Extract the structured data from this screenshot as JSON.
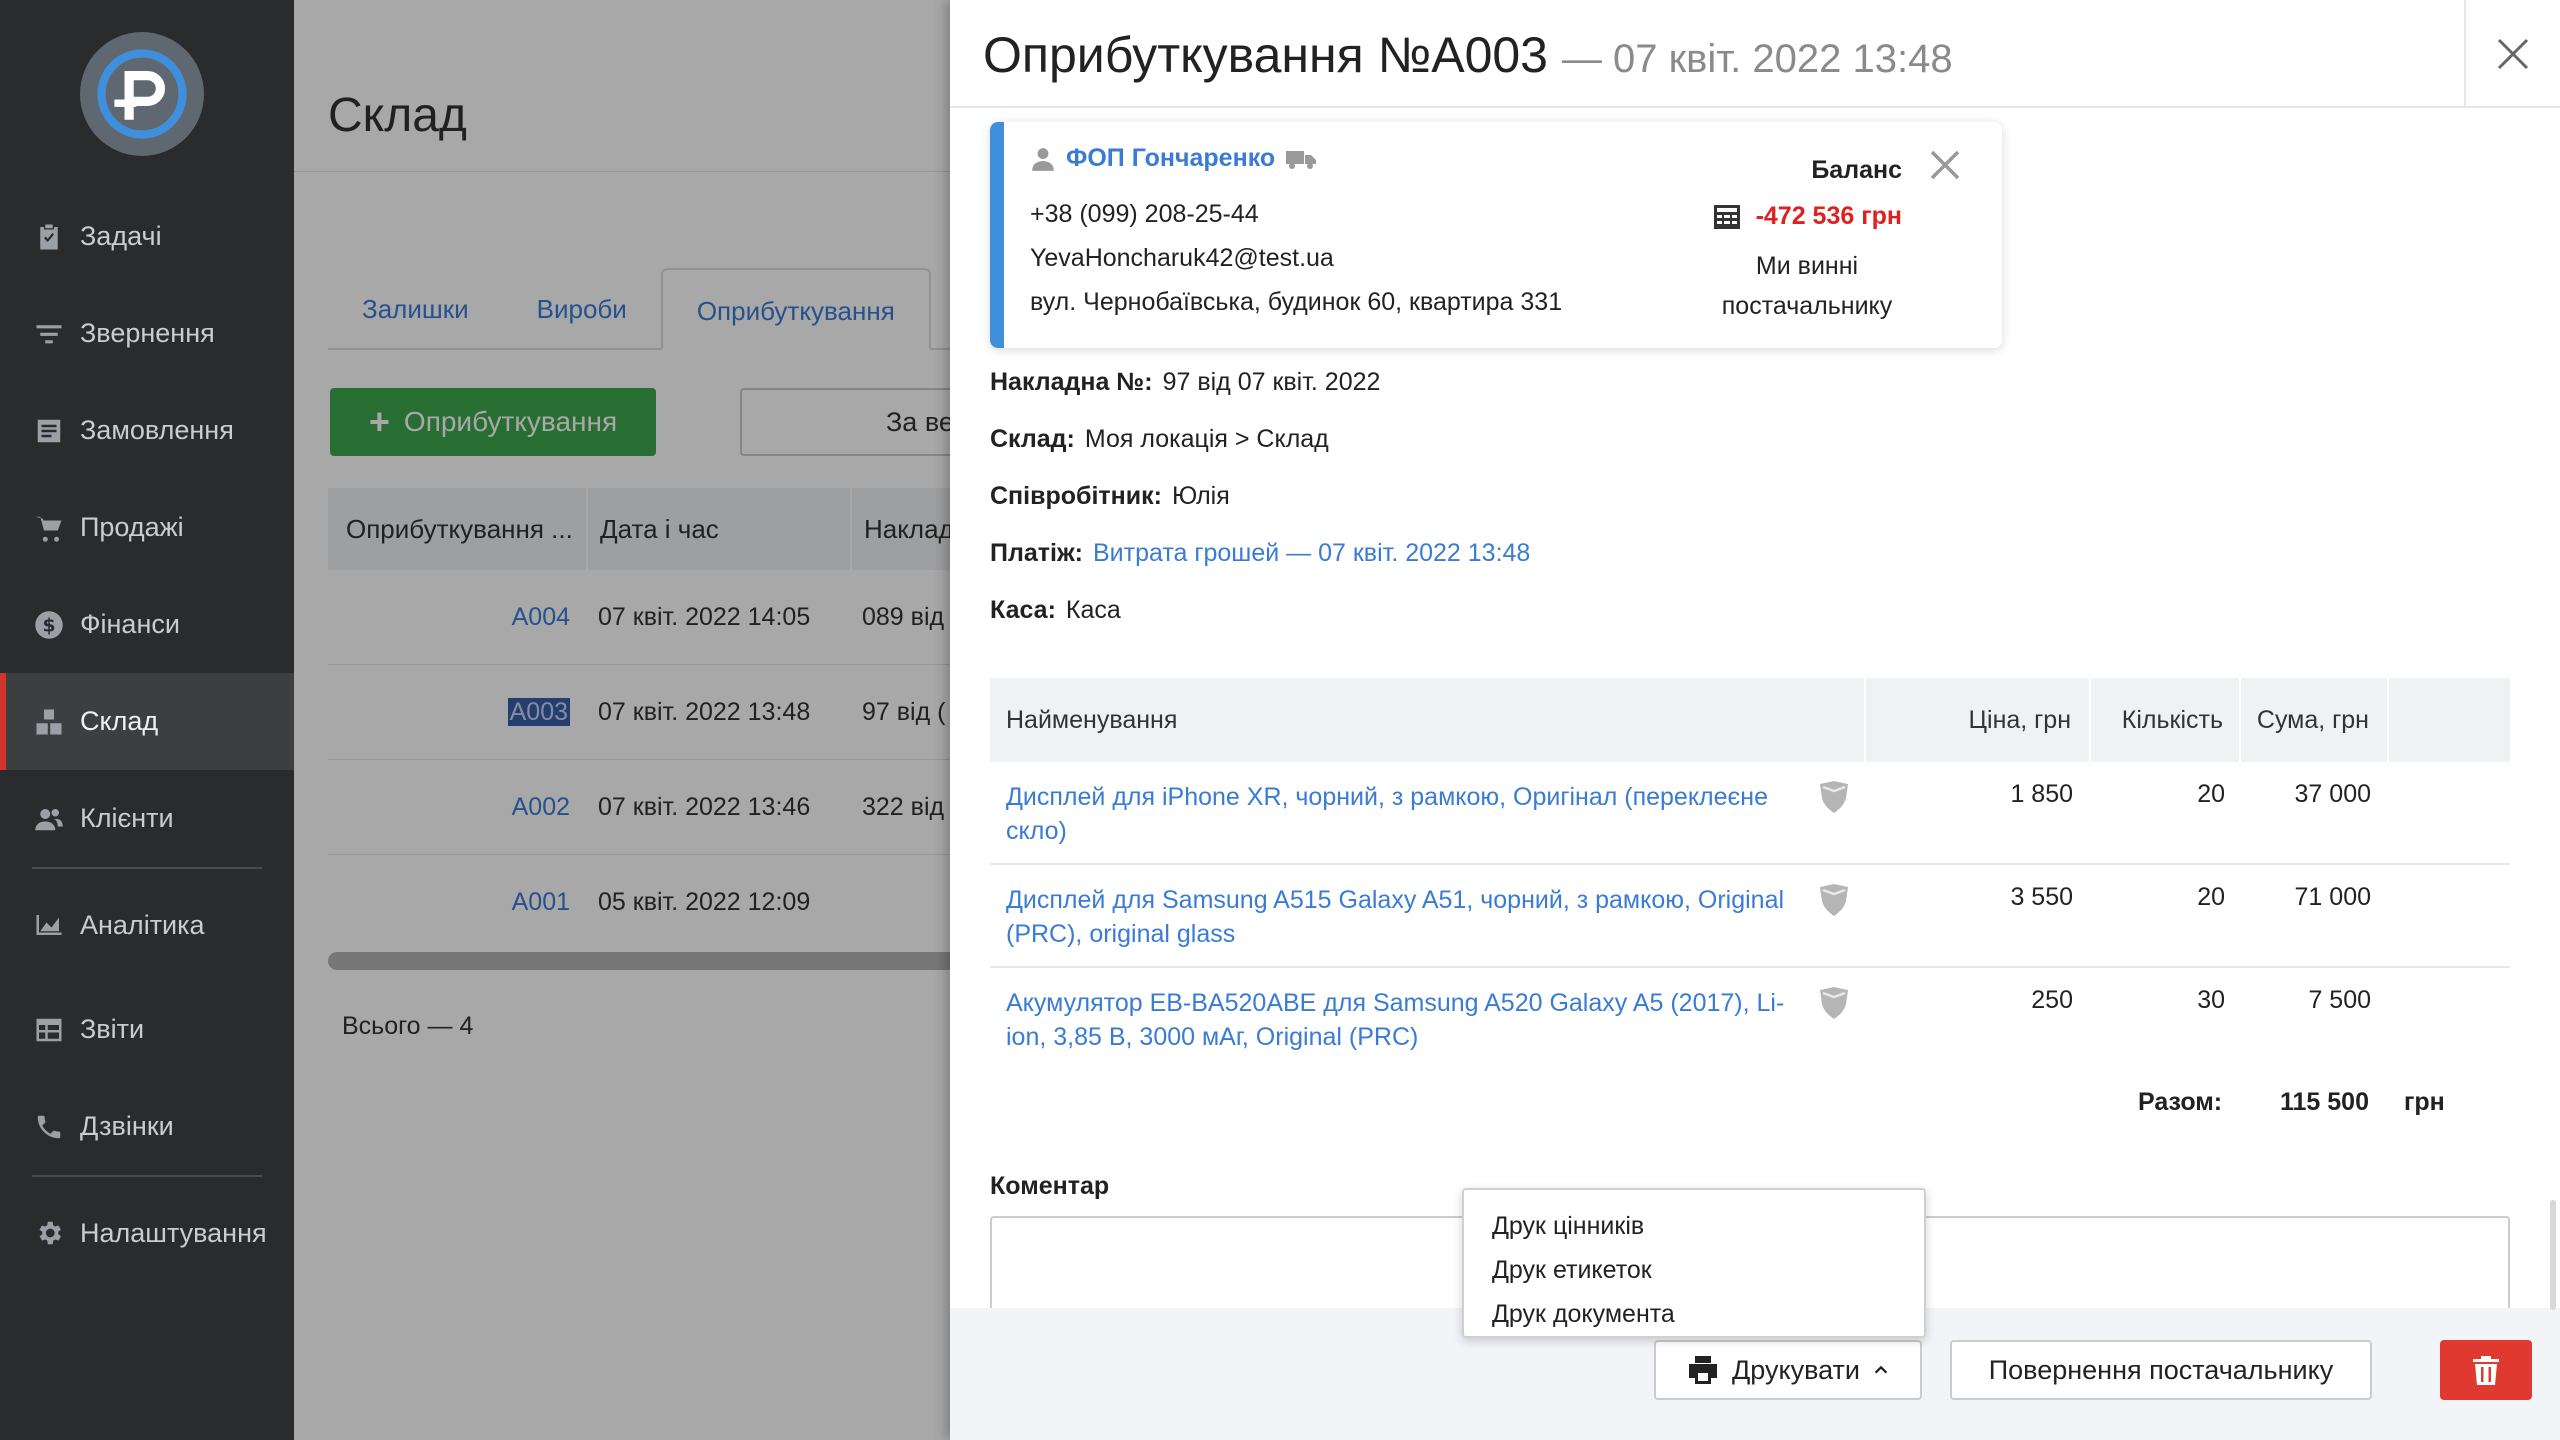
{
  "sidebar": {
    "items": [
      {
        "label": "Задачі",
        "icon": "clipboard-check-icon",
        "active": false
      },
      {
        "label": "Звернення",
        "icon": "filter-icon",
        "active": false
      },
      {
        "label": "Замовлення",
        "icon": "order-list-icon",
        "active": false
      },
      {
        "label": "Продажі",
        "icon": "cart-icon",
        "active": false
      },
      {
        "label": "Фінанси",
        "icon": "dollar-icon",
        "active": false
      },
      {
        "label": "Склад",
        "icon": "boxes-icon",
        "active": true
      },
      {
        "label": "Клієнти",
        "icon": "users-icon",
        "active": false
      },
      {
        "label": "Аналітика",
        "icon": "area-chart-icon",
        "active": false
      },
      {
        "label": "Звіти",
        "icon": "table-icon",
        "active": false
      },
      {
        "label": "Дзвінки",
        "icon": "phone-icon",
        "active": false
      },
      {
        "label": "Налаштування",
        "icon": "gear-icon",
        "active": false
      }
    ]
  },
  "page": {
    "title": "Склад",
    "tabs": [
      "Залишки",
      "Вироби",
      "Оприбуткування"
    ],
    "add_button": "Оприбуткування",
    "filter_button": "За ве",
    "table": {
      "headers": [
        "Оприбуткування ...",
        "Дата і час",
        "Наклад"
      ],
      "rows": [
        {
          "id": "A004",
          "date": "07 квіт. 2022 14:05",
          "invoice": "089 від"
        },
        {
          "id": "A003",
          "date": "07 квіт. 2022 13:48",
          "invoice": "97 від ("
        },
        {
          "id": "A002",
          "date": "07 квіт. 2022 13:46",
          "invoice": "322 від"
        },
        {
          "id": "A001",
          "date": "05 квіт. 2022 12:09",
          "invoice": ""
        }
      ]
    },
    "total": "Всього — 4"
  },
  "drawer": {
    "title": "Оприбуткування №A003",
    "subtitle": "— 07 квіт. 2022 13:48",
    "supplier": {
      "name": "ФОП Гончаренко",
      "phone": "+38 (099) 208-25-44",
      "email": "YevaHoncharuk42@test.ua",
      "address": "вул. Чернобаївська, будинок 60, квартира 331",
      "balance_label": "Баланс",
      "balance_value": "-472 536 грн",
      "balance_note": "Ми винні постачальнику"
    },
    "info": {
      "invoice_label": "Накладна №:",
      "invoice_value": "97 від 07 квіт. 2022",
      "warehouse_label": "Склад:",
      "warehouse_value": "Моя локація > Склад",
      "employee_label": "Співробітник:",
      "employee_value": "Юлія",
      "payment_label": "Платіж:",
      "payment_value": "Витрата грошей — 07 квіт. 2022 13:48",
      "cash_label": "Каса:",
      "cash_value": "Каса"
    },
    "items": {
      "headers": {
        "name": "Найменування",
        "price": "Ціна, грн",
        "qty": "Кількість",
        "sum": "Сума, грн"
      },
      "rows": [
        {
          "name": "Дисплей для iPhone XR, чорний, з рамкою, Оригінал (переклеєне скло)",
          "price": "1 850",
          "qty": "20",
          "sum": "37 000"
        },
        {
          "name": "Дисплей для Samsung A515 Galaxy A51, чорний, з рамкою, Original (PRC), original glass",
          "price": "3 550",
          "qty": "20",
          "sum": "71 000"
        },
        {
          "name": "Акумулятор EB-BA520ABE для Samsung A520 Galaxy A5 (2017), Li-ion, 3,85 В, 3000 мАг, Original (PRC)",
          "price": "250",
          "qty": "30",
          "sum": "7 500"
        }
      ],
      "total_label": "Разом:",
      "total_value": "115 500",
      "total_currency": "грн"
    },
    "comment_label": "Коментар",
    "dropdown": [
      "Друк цінників",
      "Друк етикеток",
      "Друк документа"
    ],
    "print_button": "Друкувати",
    "return_button": "Повернення постачальнику"
  },
  "colors": {
    "sidebar_bg": "#2a2b2d",
    "active_marker": "#d0342c",
    "link": "#3a7bd5",
    "add_button": "#3ea64c",
    "balance_negative": "#e02020",
    "delete_button": "#e03a30",
    "card_accent": "#3f8fdc"
  }
}
